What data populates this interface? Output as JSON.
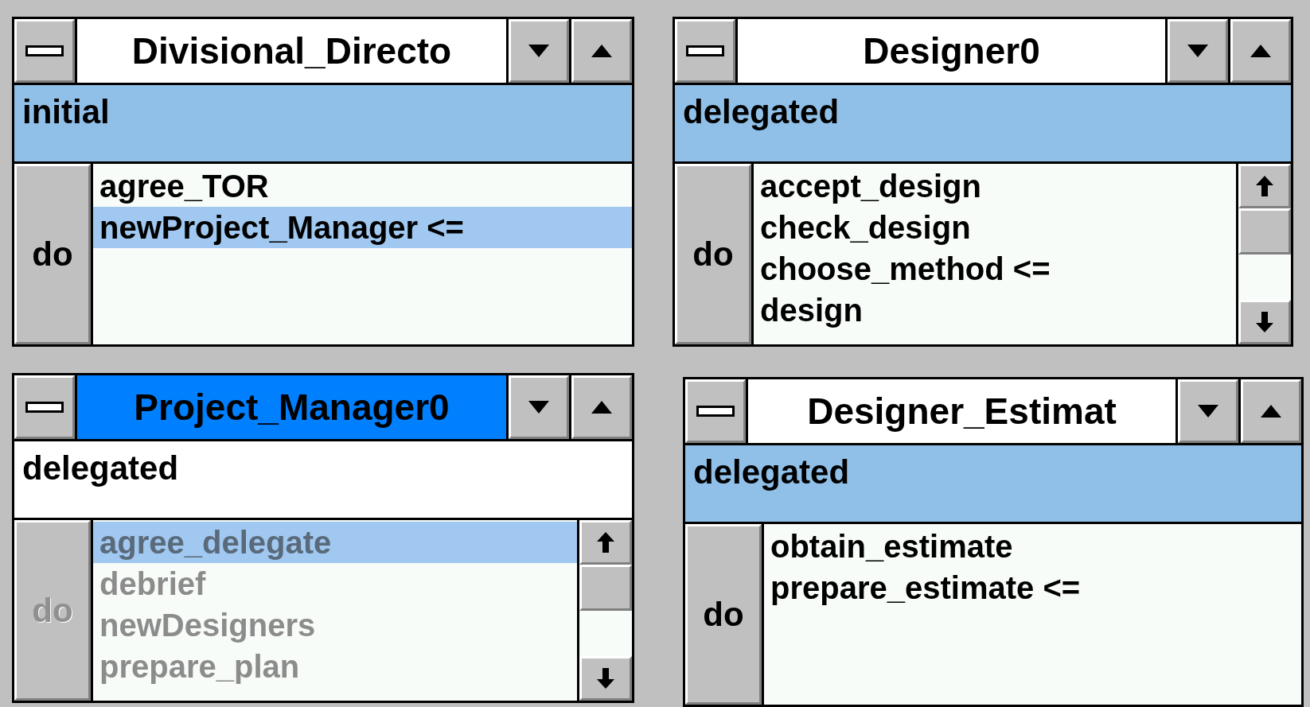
{
  "windows": [
    {
      "title": "Divisional_Directo",
      "active": false,
      "state": "initial",
      "state_highlighted": true,
      "do_label": "do",
      "do_enabled": true,
      "list_enabled": true,
      "has_scrollbar": false,
      "items": [
        {
          "label": "agree_TOR",
          "selected": false
        },
        {
          "label": "newProject_Manager <=",
          "selected": true
        }
      ]
    },
    {
      "title": "Designer0",
      "active": false,
      "state": "delegated",
      "state_highlighted": true,
      "do_label": "do",
      "do_enabled": true,
      "list_enabled": true,
      "has_scrollbar": true,
      "items": [
        {
          "label": "accept_design",
          "selected": false
        },
        {
          "label": "check_design",
          "selected": false
        },
        {
          "label": "choose_method <=",
          "selected": false
        },
        {
          "label": "design",
          "selected": false
        }
      ]
    },
    {
      "title": "Project_Manager0",
      "active": true,
      "state": "delegated",
      "state_highlighted": false,
      "do_label": "do",
      "do_enabled": false,
      "list_enabled": false,
      "has_scrollbar": true,
      "items": [
        {
          "label": "agree_delegate",
          "selected": true
        },
        {
          "label": "debrief",
          "selected": false
        },
        {
          "label": "newDesigners",
          "selected": false
        },
        {
          "label": "prepare_plan",
          "selected": false
        }
      ]
    },
    {
      "title": "Designer_Estimat",
      "active": false,
      "state": "delegated",
      "state_highlighted": true,
      "do_label": "do",
      "do_enabled": true,
      "list_enabled": true,
      "has_scrollbar": false,
      "items": [
        {
          "label": "obtain_estimate",
          "selected": false
        },
        {
          "label": "prepare_estimate <=",
          "selected": false
        }
      ]
    }
  ]
}
